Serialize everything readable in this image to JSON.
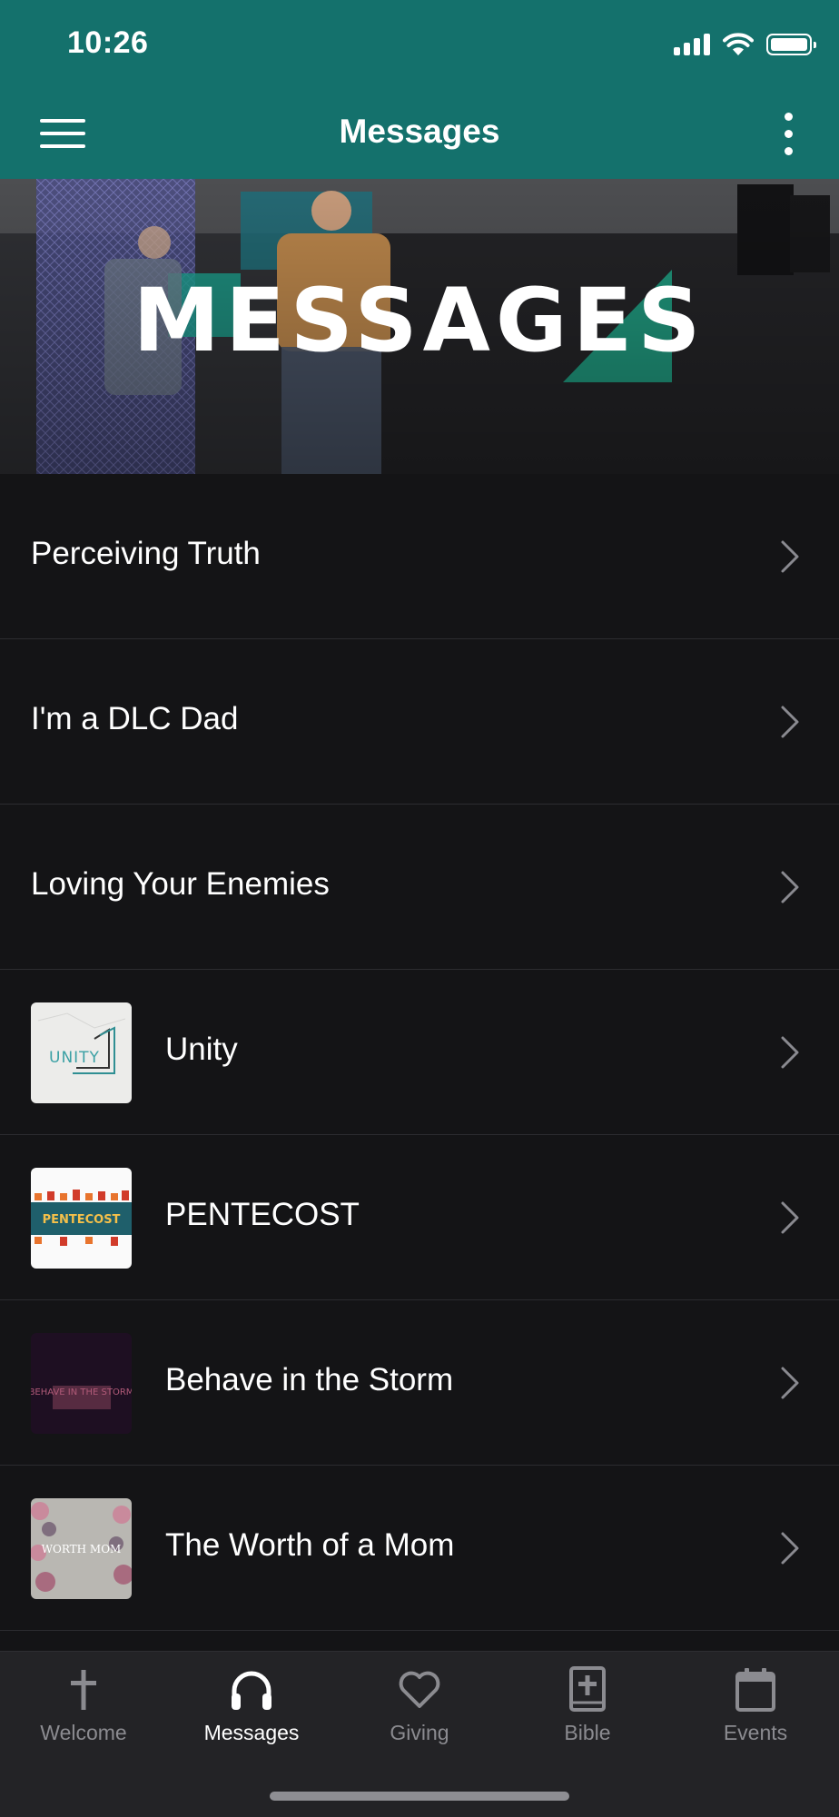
{
  "status_bar": {
    "time": "10:26"
  },
  "header": {
    "title": "Messages"
  },
  "hero": {
    "title": "MESSAGES"
  },
  "messages": [
    {
      "title": "Perceiving Truth",
      "has_thumbnail": false
    },
    {
      "title": "I'm a DLC Dad",
      "has_thumbnail": false
    },
    {
      "title": "Loving Your Enemies",
      "has_thumbnail": false
    },
    {
      "title": "Unity",
      "has_thumbnail": true,
      "thumb_text": "UNITY"
    },
    {
      "title": "PENTECOST",
      "has_thumbnail": true,
      "thumb_text": "PENTECOST"
    },
    {
      "title": "Behave in the Storm",
      "has_thumbnail": true,
      "thumb_text": "BEHAVE IN THE STORM"
    },
    {
      "title": "The Worth of a Mom",
      "has_thumbnail": true,
      "thumb_text": "WORTH MOM"
    }
  ],
  "tabs": [
    {
      "label": "Welcome",
      "icon": "cross-icon",
      "active": false
    },
    {
      "label": "Messages",
      "icon": "headphones-icon",
      "active": true
    },
    {
      "label": "Giving",
      "icon": "heart-icon",
      "active": false
    },
    {
      "label": "Bible",
      "icon": "bible-icon",
      "active": false
    },
    {
      "label": "Events",
      "icon": "calendar-icon",
      "active": false
    }
  ],
  "colors": {
    "accent": "#14716c",
    "background": "#141416",
    "tab_bar": "#232326",
    "tab_inactive": "#8b8b90"
  }
}
